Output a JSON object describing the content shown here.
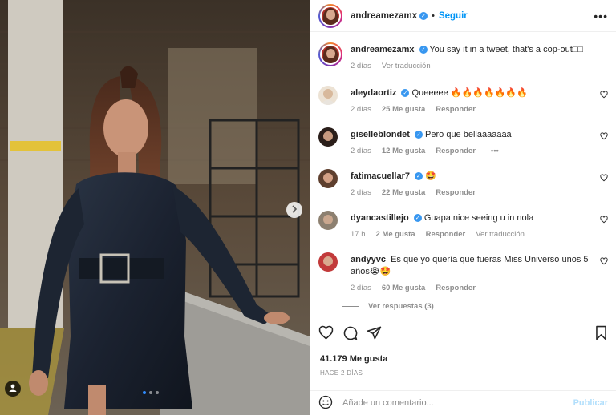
{
  "post": {
    "author": "andreamezamx",
    "follow_label": "Seguir",
    "caption": "You say it in a tweet, that's a cop-out□□",
    "caption_time": "2 días",
    "see_translation": "Ver traducción",
    "likes": "41.179 Me gusta",
    "posted_ago": "HACE 2 DÍAS"
  },
  "comments": [
    {
      "user": "aleydaortiz",
      "text": "Queeeee 🔥🔥🔥🔥🔥🔥🔥",
      "time": "2 días",
      "likes": "25 Me gusta",
      "reply": "Responder",
      "color": "#e8d9c8"
    },
    {
      "user": "giselleblondet",
      "text": "Pero que bellaaaaaaa",
      "time": "2 días",
      "likes": "12 Me gusta",
      "reply": "Responder",
      "extra": "•••",
      "color": "#3b2a25"
    },
    {
      "user": "fatimacuellar7",
      "text": "🤩",
      "time": "2 días",
      "likes": "22 Me gusta",
      "reply": "Responder",
      "color": "#6b4a3a"
    },
    {
      "user": "dyancastillejo",
      "text": "Guapa nice seeing u in nola",
      "time": "17 h",
      "likes": "2 Me gusta",
      "reply": "Responder",
      "translate": "Ver traducción",
      "color": "#8a7a6a"
    },
    {
      "user": "andyyvc",
      "text": "Es que yo quería que fueras Miss Universo unos 5 años😭🤩",
      "time": "2 días",
      "likes": "60 Me gusta",
      "reply": "Responder",
      "color": "#c03a3a"
    }
  ],
  "view_replies": "Ver respuestas (3)",
  "composer": {
    "placeholder": "Añade un comentario...",
    "publish": "Publicar"
  },
  "icons": [
    "heart-icon",
    "comment-icon",
    "share-icon",
    "bookmark-icon",
    "emoji-icon",
    "more-icon",
    "chevron-right-icon",
    "user-tag-icon",
    "verified-icon"
  ],
  "colors": {
    "accent": "#0095f6",
    "publish_disabled": "#b2dffc",
    "verified": "#3897f0"
  }
}
